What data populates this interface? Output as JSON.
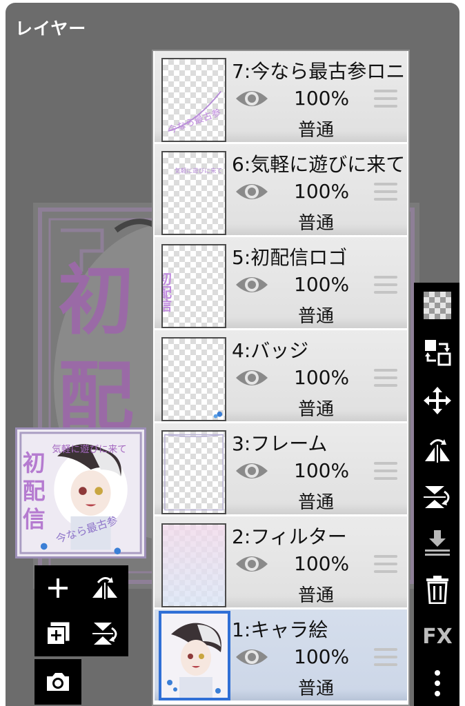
{
  "panel": {
    "title": "レイヤー"
  },
  "layers": [
    {
      "name": "7:今なら最古参ロニ",
      "opacity": "100%",
      "blend": "普通",
      "selected": false
    },
    {
      "name": "6:気軽に遊びに来て",
      "opacity": "100%",
      "blend": "普通",
      "selected": false
    },
    {
      "name": "5:初配信ロゴ",
      "opacity": "100%",
      "blend": "普通",
      "selected": false
    },
    {
      "name": "4:バッジ",
      "opacity": "100%",
      "blend": "普通",
      "selected": false
    },
    {
      "name": "3:フレーム",
      "opacity": "100%",
      "blend": "普通",
      "selected": false
    },
    {
      "name": "2:フィルター",
      "opacity": "100%",
      "blend": "普通",
      "selected": false
    },
    {
      "name": "1:キャラ絵",
      "opacity": "100%",
      "blend": "普通",
      "selected": true
    }
  ],
  "thumb_text": {
    "layer7": "今なら最古参",
    "layer6": "気軽に遊びに来て",
    "layer5": "初配信"
  },
  "preview": {
    "logo_text": "初配信",
    "subtitle_text": "気軽に遊びに来て",
    "bottom_text": "今なら最古参"
  },
  "toolbar_right": {
    "items": [
      "transparency-icon",
      "layer-swap-icon",
      "move-icon",
      "flip-horizontal-icon",
      "flip-vertical-icon",
      "merge-down-icon",
      "trash-icon",
      "fx-icon",
      "more-icon"
    ],
    "fx_label": "FX"
  },
  "tools_left": [
    "add-layer-icon",
    "flip-horizontal-icon",
    "duplicate-layer-icon",
    "flip-vertical-icon",
    "camera-icon"
  ],
  "colors": {
    "panel_bg": "#6c6c6c",
    "selected_row": "#cdd7e8",
    "selected_border": "#2f6fd6",
    "logo_purple": "#b57bd0"
  }
}
